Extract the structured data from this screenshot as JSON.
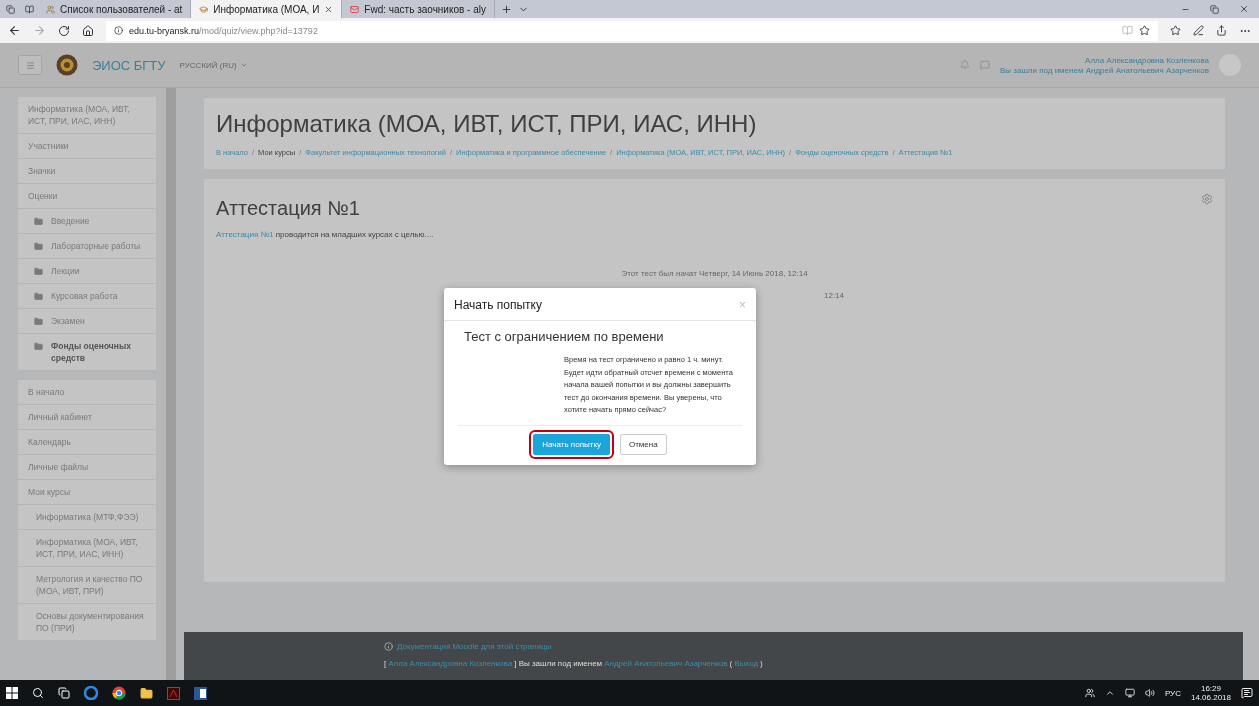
{
  "browser": {
    "tabs": [
      {
        "title": "Список пользователей - at",
        "selected": false,
        "kind": "moodle"
      },
      {
        "title": "Информатика (МОА, И",
        "selected": true,
        "kind": "hat"
      },
      {
        "title": "Fwd: часть заочников - aly",
        "selected": false,
        "kind": "mail"
      }
    ],
    "url": {
      "domain": "edu.tu-bryansk.ru",
      "path": "/mod/quiz/view.php?id=13792"
    }
  },
  "header": {
    "brand": "ЭИОС БГТУ",
    "language": "РУССКИЙ (RU)",
    "user_name": "Алла Александровна Козленкова",
    "login_as": "Вы зашли под именем Андрей Анатольевич Азарченков"
  },
  "sidebar": {
    "course_nav": [
      {
        "label": "Информатика (МОА, ИВТ, ИСТ, ПРИ, ИАС, ИНН)",
        "kind": "link",
        "bold": false
      },
      {
        "label": "Участники",
        "kind": "link",
        "bold": false
      },
      {
        "label": "Значки",
        "kind": "link",
        "bold": false
      },
      {
        "label": "Оценки",
        "kind": "link",
        "bold": false
      },
      {
        "label": "Введение",
        "kind": "folder",
        "bold": false
      },
      {
        "label": "Лабораторные работы",
        "kind": "folder",
        "bold": false
      },
      {
        "label": "Лекции",
        "kind": "folder",
        "bold": false
      },
      {
        "label": "Курсовая работа",
        "kind": "folder",
        "bold": false
      },
      {
        "label": "Экзамен",
        "kind": "folder",
        "bold": false
      },
      {
        "label": "Фонды оценочных средств",
        "kind": "folder",
        "bold": true
      }
    ],
    "site_nav": [
      {
        "label": "В начало"
      },
      {
        "label": "Личный кабинет"
      },
      {
        "label": "Календарь"
      },
      {
        "label": "Личные файлы"
      },
      {
        "label": "Мои курсы",
        "children": [
          {
            "label": "Информатика (МТФ,ФЭЭ)"
          },
          {
            "label": "Информатика (МОА, ИВТ, ИСТ, ПРИ, ИАС, ИНН)"
          },
          {
            "label": "Метрология и качество ПО (МОА, ИВТ, ПРИ)"
          },
          {
            "label": "Основы документирования ПО (ПРИ)"
          }
        ]
      }
    ]
  },
  "course": {
    "title": "Информатика (МОА, ИВТ, ИСТ, ПРИ, ИАС, ИНН)",
    "separator": "/",
    "breadcrumbs": [
      {
        "label": "В начало",
        "link": true
      },
      {
        "label": "Мои курсы",
        "link": false
      },
      {
        "label": "Факультет информационных технологий",
        "link": true
      },
      {
        "label": "Информатика и программное обеспечение",
        "link": true
      },
      {
        "label": "Информатика (МОА, ИВТ, ИСТ, ПРИ, ИАС, ИНН)",
        "link": true
      },
      {
        "label": "Фонды оценочных средств",
        "link": true
      },
      {
        "label": "Аттестация №1",
        "link": true
      }
    ]
  },
  "quiz": {
    "title": "Аттестация №1",
    "intro_link": "Аттестация №1",
    "intro_text": "проводится на младших курсах с целью....",
    "started_line": "Этот тест был начат Четверг, 14 Июнь 2018, 12:14",
    "partial_line": "12:14"
  },
  "modal": {
    "title": "Начать попытку",
    "close": "×",
    "heading": "Тест с ограничением по времени",
    "message": "Время на тест ограничено и равно 1 ч. минут. Будет идти обратный отсчет времени с момента начала вашей попытки и вы должны завершить тест до окончания времени. Вы уверены, что хотите начать прямо сейчас?",
    "buttons": [
      {
        "label": "Начать попытку",
        "kind": "primary",
        "highlighted": true
      },
      {
        "label": "Отмена",
        "kind": "secondary",
        "highlighted": false
      }
    ]
  },
  "footer": {
    "docs_link": "Документация Moodle для этой страницы",
    "login_parts": [
      {
        "text": "[",
        "link": false
      },
      {
        "text": "Алла Александровна Козленкова",
        "link": true
      },
      {
        "text": "] Вы зашли под именем",
        "link": false
      },
      {
        "text": "Андрей Анатольевич Азарченков",
        "link": true
      },
      {
        "text": "(",
        "link": false
      },
      {
        "text": "Выход",
        "link": true
      },
      {
        "text": ")",
        "link": false
      }
    ]
  },
  "taskbar": {
    "language": "РУС",
    "time": "16:29",
    "date": "14.06.2018"
  }
}
